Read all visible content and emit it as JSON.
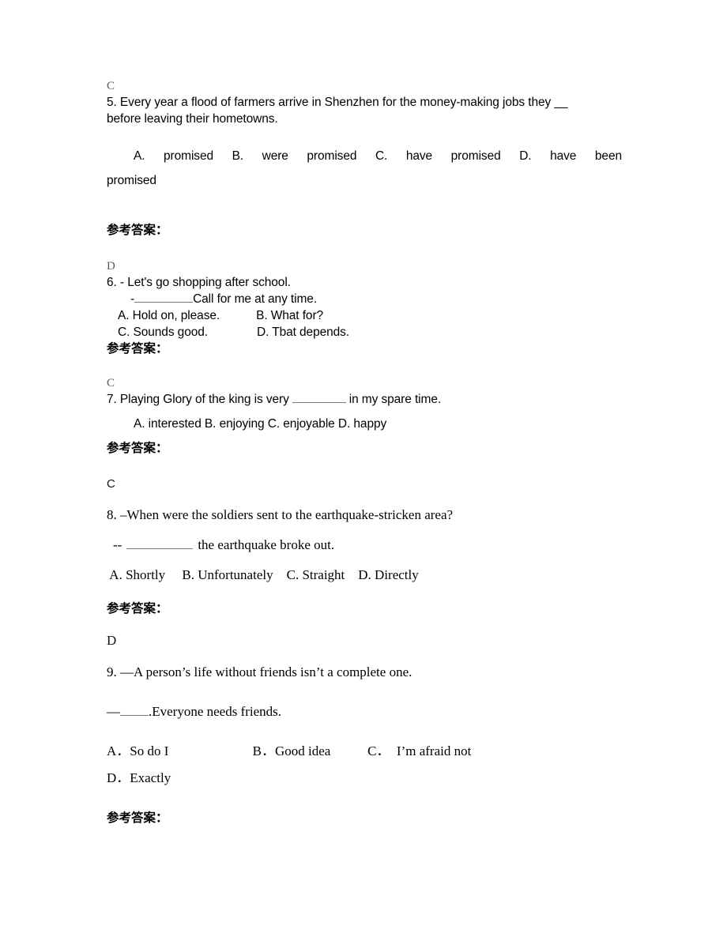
{
  "document": {
    "reference_answer_label": "参考答案："
  },
  "blocks": [
    {
      "answer_letter": "C",
      "number": "5.",
      "question_line1": "5. Every year a flood of farmers arrive in Shenzhen for the money-making jobs they __",
      "question_line2": "before leaving their hometowns.",
      "options_line": "A. promised      B. were promised      C. have promised      D.      have      been",
      "options_overflow": "promised",
      "options": [
        "A. promised",
        "B. were promised",
        "C. have promised",
        "D. have been promised"
      ]
    },
    {
      "answer_letter": "D",
      "number": "6.",
      "question_line1": "6. - Let's go shopping after school.",
      "question_line2_pre": "-",
      "question_line2_post": "Call for me at any time.",
      "option_a": "A. Hold on, please.",
      "option_b": "B. What for?",
      "option_c": "C. Sounds good.",
      "option_d": "D. Tbat depends.",
      "options": [
        "A. Hold on, please.",
        "B. What for?",
        "C. Sounds good.",
        "D. Tbat depends."
      ]
    },
    {
      "answer_letter": "C",
      "number": "7.",
      "question_line1_pre": "7. Playing Glory of the king is very",
      "question_line1_post": "in my spare time.",
      "options_line": "A. interested    B. enjoying    C. enjoyable    D. happy",
      "options": [
        "A. interested",
        "B. enjoying",
        "C. enjoyable",
        "D. happy"
      ]
    },
    {
      "answer_letter": "C",
      "number": "8.",
      "question_line1": "8. –When were the soldiers sent to the earthquake-stricken area?",
      "question_line2_pre": "--",
      "question_line2_post": "the earthquake broke out.",
      "options_line": " A. Shortly     B. Unfortunately    C. Straight    D. Directly",
      "options": [
        "A. Shortly",
        "B. Unfortunately",
        "C. Straight",
        "D. Directly"
      ]
    },
    {
      "answer_letter": "D",
      "number": "9.",
      "question_line1": "9. —A person’s life without friends isn’t a complete one.",
      "question_line2_pre": "—",
      "question_line2_post": ".Everyone needs friends.",
      "options_line1": "A．So do I                         B．Good idea           C．　I’m afraid not",
      "options_line2": "D．Exactly",
      "options": [
        "A．So do I",
        "B．Good idea",
        "C．I’m afraid not",
        "D．Exactly"
      ]
    }
  ]
}
